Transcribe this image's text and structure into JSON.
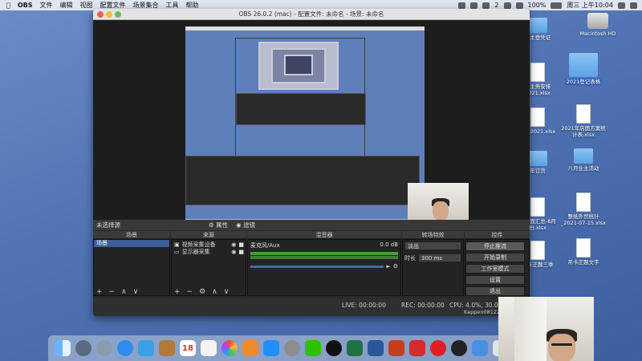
{
  "menubar": {
    "app": "OBS",
    "items": [
      "文件",
      "编辑",
      "视图",
      "配置文件",
      "场景集合",
      "工具",
      "帮助"
    ],
    "right": {
      "battery": "100%",
      "clock": "周三 上午10:04",
      "badge": "2"
    }
  },
  "window": {
    "title": "OBS 26.0.2 (mac) - 配置文件: 未命名 - 场景: 未命名"
  },
  "source_toolbar": {
    "no_source": "未选择源",
    "properties": "属性",
    "filters": "滤镜"
  },
  "panels": {
    "scenes": {
      "header": "场景",
      "items": [
        "场景"
      ]
    },
    "sources": {
      "header": "来源",
      "items": [
        "视频采集设备",
        "显示器采集"
      ]
    },
    "mixer": {
      "header": "混音器",
      "track": "麦克风/Aux",
      "db": "0.0 dB"
    },
    "transitions": {
      "header": "转场特效",
      "type": "淡出",
      "duration_label": "时长",
      "duration_value": "300 ms"
    },
    "controls": {
      "header": "控件",
      "buttons": [
        "停止推流",
        "开始录制",
        "工作室模式",
        "设置",
        "退出"
      ]
    }
  },
  "statusbar": {
    "live": "LIVE: 00:00:00",
    "rec": "REC: 00:00:00",
    "cpu": "CPU: 4.0%, 30.00 fps",
    "user": "Kappen08122"
  },
  "desktop_icons": [
    {
      "label": "Macintosh HD",
      "kind": "disk"
    },
    {
      "label": "2021登记表格",
      "kind": "folder"
    },
    {
      "label": "2021年店面方案统计表.xlsx",
      "kind": "file"
    },
    {
      "label": "八月业主活动",
      "kind": "folder"
    },
    {
      "label": "整纸外贸统计_2021-07-15.xlsx",
      "kind": "file"
    },
    {
      "label": "吊卡正题文字",
      "kind": "file"
    },
    {
      "label": "业主登凭证",
      "kind": "folder"
    },
    {
      "label": "业主务安排2021.xlsx",
      "kind": "file"
    },
    {
      "label": "证据2021.xlsx",
      "kind": "file"
    },
    {
      "label": "年订货",
      "kind": "folder"
    },
    {
      "label": "计店面汇总-8月份.xlsx",
      "kind": "file"
    },
    {
      "label": "吊卡正题三季",
      "kind": "file"
    }
  ],
  "colors": {
    "desktop": "#4f73b3",
    "obs_bg": "#2b2b2b",
    "selected": "#3b5f93",
    "meter": "#4c9a3c"
  },
  "dock_icons": [
    "finder-icon",
    "launchpad-icon",
    "rocket-icon",
    "safari-icon",
    "mail-icon",
    "notes-icon",
    "calendar-icon",
    "reminders-icon",
    "photos-icon",
    "books-icon",
    "appstore-icon",
    "settings-icon",
    "wechat-icon",
    "qq-icon",
    "excel-icon",
    "word-icon",
    "powerpoint-icon",
    "pdf-icon",
    "netease-icon",
    "obs-icon",
    "downloads-icon",
    "trash-icon"
  ],
  "dock_calendar": "18"
}
